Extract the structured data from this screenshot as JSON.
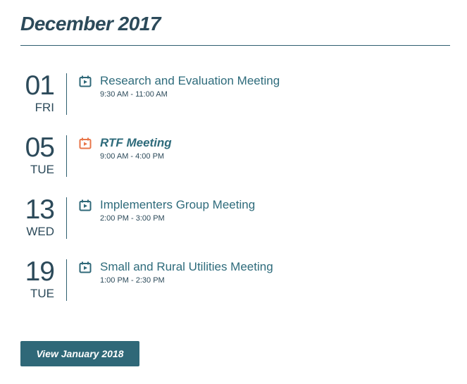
{
  "header": {
    "month_title": "December 2017"
  },
  "colors": {
    "primary": "#2f6878",
    "accent": "#e8764a",
    "text": "#2c4a5a"
  },
  "events": [
    {
      "day": "01",
      "weekday": "FRI",
      "title": "Research and Evaluation Meeting",
      "time": "9:30 AM - 11:00 AM",
      "featured": false,
      "icon": "calendar-play-icon"
    },
    {
      "day": "05",
      "weekday": "TUE",
      "title": "RTF Meeting",
      "time": "9:00 AM - 4:00 PM",
      "featured": true,
      "icon": "calendar-play-icon"
    },
    {
      "day": "13",
      "weekday": "WED",
      "title": "Implementers Group Meeting",
      "time": "2:00 PM - 3:00 PM",
      "featured": false,
      "icon": "calendar-play-icon"
    },
    {
      "day": "19",
      "weekday": "TUE",
      "title": "Small and Rural Utilities Meeting",
      "time": "1:00 PM - 2:30 PM",
      "featured": false,
      "icon": "calendar-play-icon"
    }
  ],
  "footer": {
    "next_month_label": "View January 2018"
  }
}
